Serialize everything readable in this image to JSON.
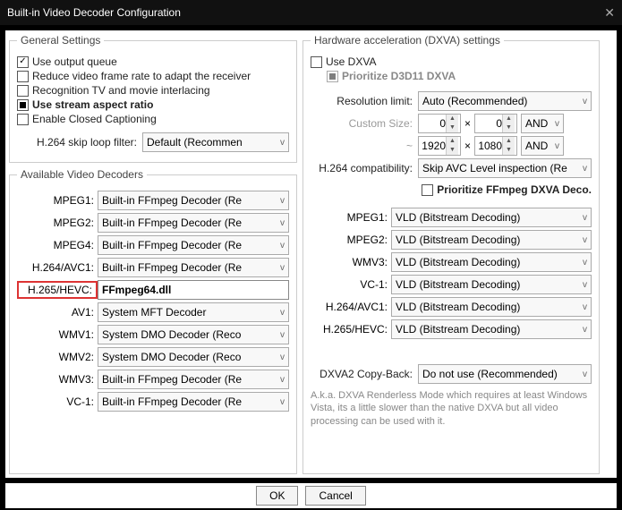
{
  "window": {
    "title": "Built-in Video Decoder Configuration"
  },
  "general": {
    "legend": "General Settings",
    "use_output_queue": "Use output queue",
    "reduce_frame_rate": "Reduce video frame rate to adapt the receiver",
    "recognition_tv": "Recognition TV and movie interlacing",
    "use_stream_aspect": "Use stream aspect ratio",
    "enable_cc": "Enable Closed Captioning",
    "skip_loop_label": "H.264 skip loop filter:",
    "skip_loop_value": "Default (Recommen"
  },
  "decoders": {
    "legend": "Available Video Decoders",
    "rows": [
      {
        "label": "MPEG1:",
        "value": "Built-in FFmpeg Decoder (Re",
        "type": "select"
      },
      {
        "label": "MPEG2:",
        "value": "Built-in FFmpeg Decoder (Re",
        "type": "select"
      },
      {
        "label": "MPEG4:",
        "value": "Built-in FFmpeg Decoder (Re",
        "type": "select"
      },
      {
        "label": "H.264/AVC1:",
        "value": "Built-in FFmpeg Decoder (Re",
        "type": "select"
      },
      {
        "label": "H.265/HEVC:",
        "value": "FFmpeg64.dll",
        "type": "text",
        "highlight": true
      },
      {
        "label": "AV1:",
        "value": "System MFT Decoder",
        "type": "select"
      },
      {
        "label": "WMV1:",
        "value": "System DMO Decoder (Reco",
        "type": "select"
      },
      {
        "label": "WMV2:",
        "value": "System DMO Decoder (Reco",
        "type": "select"
      },
      {
        "label": "WMV3:",
        "value": "Built-in FFmpeg Decoder (Re",
        "type": "select"
      },
      {
        "label": "VC-1:",
        "value": "Built-in FFmpeg Decoder (Re",
        "type": "select"
      }
    ]
  },
  "hw": {
    "legend": "Hardware acceleration (DXVA) settings",
    "use_dxva": "Use DXVA",
    "prioritize_d3d11": "Prioritize D3D11 DXVA",
    "res_limit_label": "Resolution limit:",
    "res_limit_value": "Auto (Recommended)",
    "custom_size_label": "Custom Size:",
    "cs_w": "0",
    "cs_h": "0",
    "cs_logic1": "AND",
    "tilde": "~",
    "cs_w2": "1920",
    "cs_h2": "1080",
    "cs_logic2": "AND",
    "compat_label": "H.264 compatibility:",
    "compat_value": "Skip AVC Level inspection (Re",
    "prioritize_ffmpeg": "Prioritize FFmpeg DXVA Deco.",
    "hw_rows": [
      {
        "label": "MPEG1:",
        "value": "VLD (Bitstream Decoding)"
      },
      {
        "label": "MPEG2:",
        "value": "VLD (Bitstream Decoding)"
      },
      {
        "label": "WMV3:",
        "value": "VLD (Bitstream Decoding)"
      },
      {
        "label": "VC-1:",
        "value": "VLD (Bitstream Decoding)"
      },
      {
        "label": "H.264/AVC1:",
        "value": "VLD (Bitstream Decoding)"
      },
      {
        "label": "H.265/HEVC:",
        "value": "VLD (Bitstream Decoding)"
      }
    ],
    "copyback_label": "DXVA2 Copy-Back:",
    "copyback_value": "Do not use (Recommended)",
    "helptext": "A.k.a. DXVA Renderless Mode which requires at least Windows Vista, its a little slower than the native DXVA but all video processing can be used with it."
  },
  "footer": {
    "ok": "OK",
    "cancel": "Cancel"
  }
}
